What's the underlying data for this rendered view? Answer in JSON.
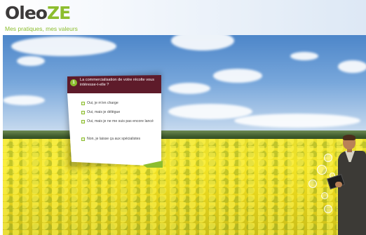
{
  "logo": {
    "main": "Oleo",
    "accent": "ZE",
    "tagline": "Mes pratiques, mes valeurs"
  },
  "question": {
    "number": "1",
    "text": "La commercialisation de votre récolte vous intéresse-t-elle ?",
    "options": [
      {
        "label": "Oui, je m'en charge"
      },
      {
        "label": "Oui, mais je délègue"
      },
      {
        "label": "Oui, mais je ne me suis pas encore lancé"
      },
      {
        "label": "Non, je laisse ça aux spécialistes"
      }
    ]
  },
  "colors": {
    "brand_green": "#8cbd2e",
    "question_header": "#5e1b2a",
    "logo_dark": "#3c3a3a"
  },
  "icons": [
    "checkbox-icon",
    "bubble-icon"
  ]
}
